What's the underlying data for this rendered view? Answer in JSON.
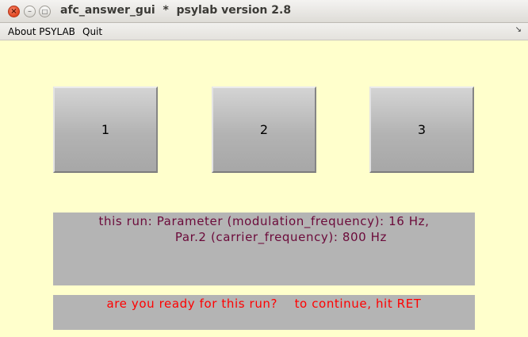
{
  "window": {
    "title": "afc_answer_gui  *  psylab version 2.8",
    "close_glyph": "×",
    "minimize_glyph": "–",
    "maximize_glyph": "□"
  },
  "menu": {
    "items": [
      {
        "label": "About PSYLAB"
      },
      {
        "label": "Quit"
      }
    ],
    "dock_arrow": "↘"
  },
  "answers": [
    {
      "label": "1"
    },
    {
      "label": "2"
    },
    {
      "label": "3"
    }
  ],
  "info": {
    "line1": "this run: Parameter (modulation_frequency): 16 Hz,",
    "line2": "        Par.2 (carrier_frequency): 800 Hz"
  },
  "prompt": {
    "text": "are you ready for this run?    to continue, hit RET"
  },
  "colors": {
    "background": "#ffffcc",
    "panel": "#b4b4b4",
    "info_text": "#6b0a3a",
    "prompt_text": "#ff0000",
    "close_button": "#e0451f"
  }
}
